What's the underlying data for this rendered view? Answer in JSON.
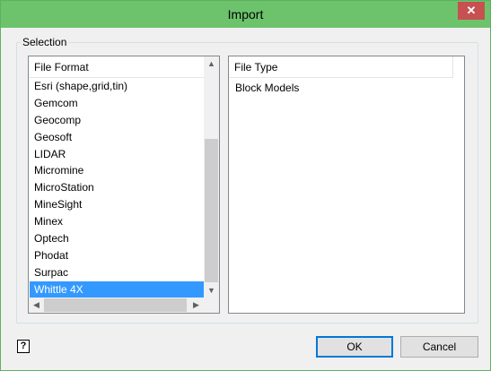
{
  "window": {
    "title": "Import",
    "close_label": "✕"
  },
  "selection": {
    "group_label": "Selection",
    "file_format": {
      "header": "File Format",
      "items": [
        "Esri (shape,grid,tin)",
        "Gemcom",
        "Geocomp",
        "Geosoft",
        "LIDAR",
        "Micromine",
        "MicroStation",
        "MineSight",
        "Minex",
        "Optech",
        "Phodat",
        "Surpac",
        "Whittle 4X"
      ],
      "selected": "Whittle 4X"
    },
    "file_type": {
      "header": "File Type",
      "items": [
        "Block Models"
      ]
    }
  },
  "footer": {
    "help_glyph": "?",
    "ok_label": "OK",
    "cancel_label": "Cancel"
  }
}
